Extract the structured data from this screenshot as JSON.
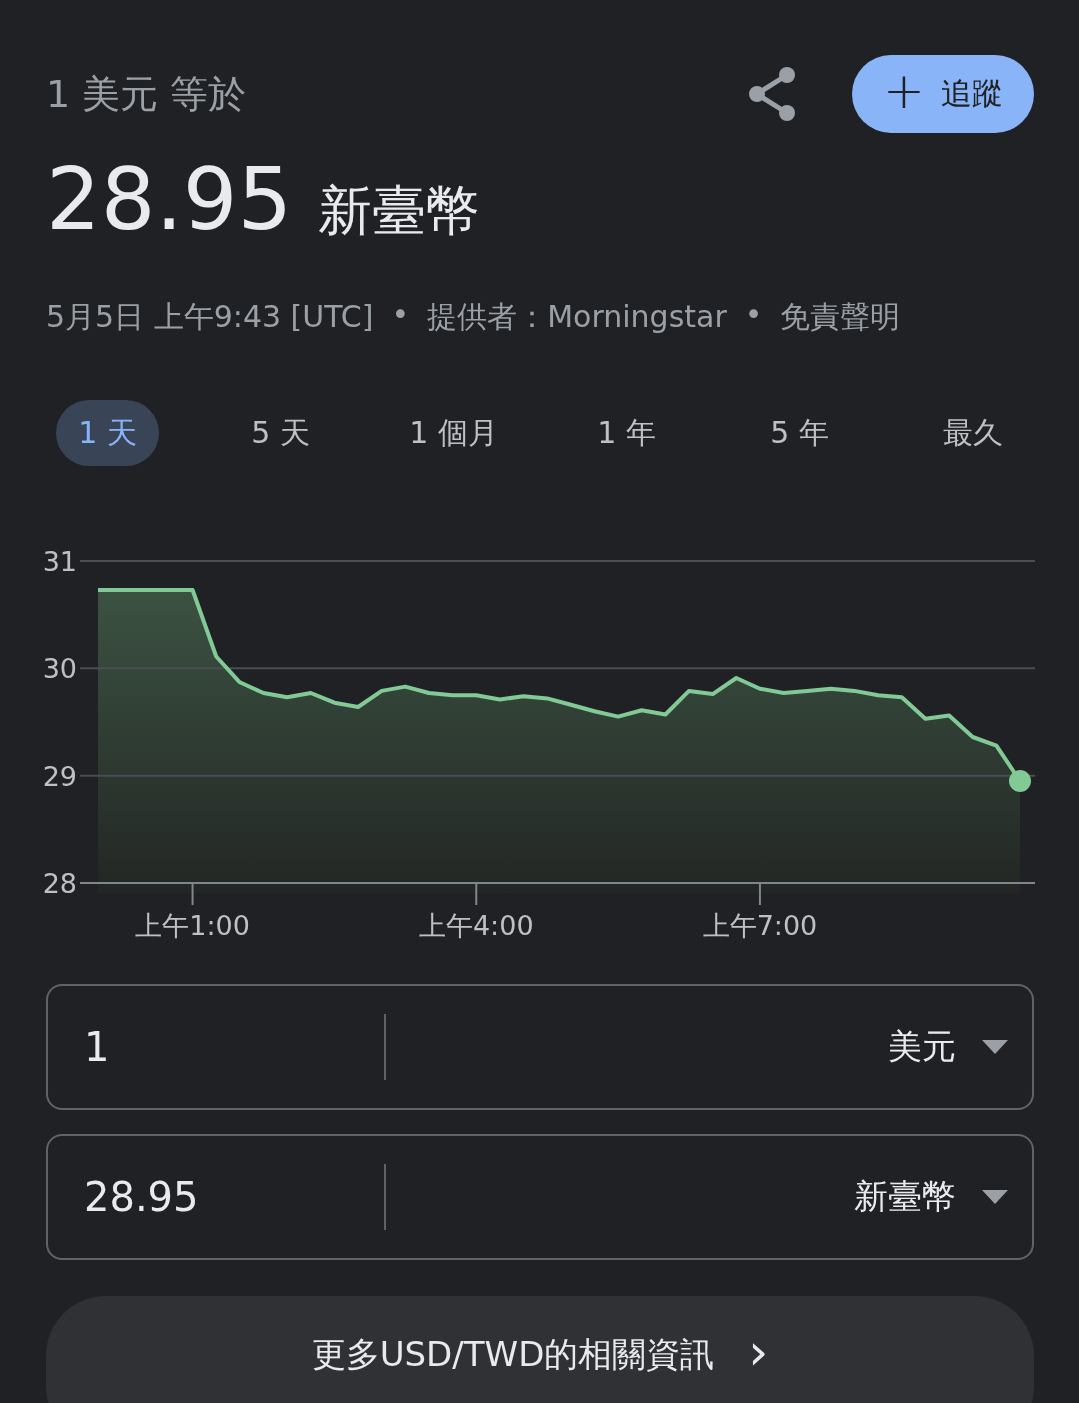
{
  "header": {
    "title": "1 美元 等於",
    "follow_button": {
      "icon": "+",
      "label": "追蹤"
    }
  },
  "rate": {
    "value": "28.95",
    "currency": "新臺幣"
  },
  "meta": [
    "5月5日 上午9:43 [UTC]",
    "•",
    "提供者：Morningstar",
    "•",
    "免責聲明"
  ],
  "ranges": [
    {
      "label": "1 天",
      "selected": true
    },
    {
      "label": "5 天",
      "selected": false
    },
    {
      "label": "1 個月",
      "selected": false
    },
    {
      "label": "1 年",
      "selected": false
    },
    {
      "label": "5 年",
      "selected": false
    },
    {
      "label": "最久",
      "selected": false
    }
  ],
  "chart_data": {
    "type": "area",
    "ylim": [
      28,
      31
    ],
    "yticks": [
      28,
      29,
      30,
      31
    ],
    "categories": [
      null,
      null,
      null,
      null,
      "上午1:00",
      null,
      null,
      null,
      null,
      null,
      null,
      null,
      null,
      null,
      null,
      null,
      "上午4:00",
      null,
      null,
      null,
      null,
      null,
      null,
      null,
      null,
      null,
      null,
      null,
      "上午7:00",
      null,
      null,
      null,
      null,
      null,
      null,
      null,
      null,
      null,
      null,
      null
    ],
    "series": [
      {
        "color": "#81c995",
        "values": [
          30.73,
          30.73,
          30.73,
          30.73,
          30.73,
          30.11,
          29.87,
          29.77,
          29.73,
          29.77,
          29.68,
          29.64,
          29.79,
          29.83,
          29.77,
          29.75,
          29.75,
          29.71,
          29.74,
          29.72,
          29.66,
          29.6,
          29.55,
          29.61,
          29.57,
          29.79,
          29.76,
          29.91,
          29.81,
          29.77,
          29.79,
          29.81,
          29.79,
          29.75,
          29.73,
          29.53,
          29.56,
          29.36,
          29.28,
          28.95
        ]
      }
    ]
  },
  "converter": [
    {
      "amount": "1",
      "currency": "美元"
    },
    {
      "amount": "28.95",
      "currency": "新臺幣"
    }
  ],
  "more_button": {
    "label": "更多USD/TWD的相關資訊",
    "icon": "›"
  }
}
